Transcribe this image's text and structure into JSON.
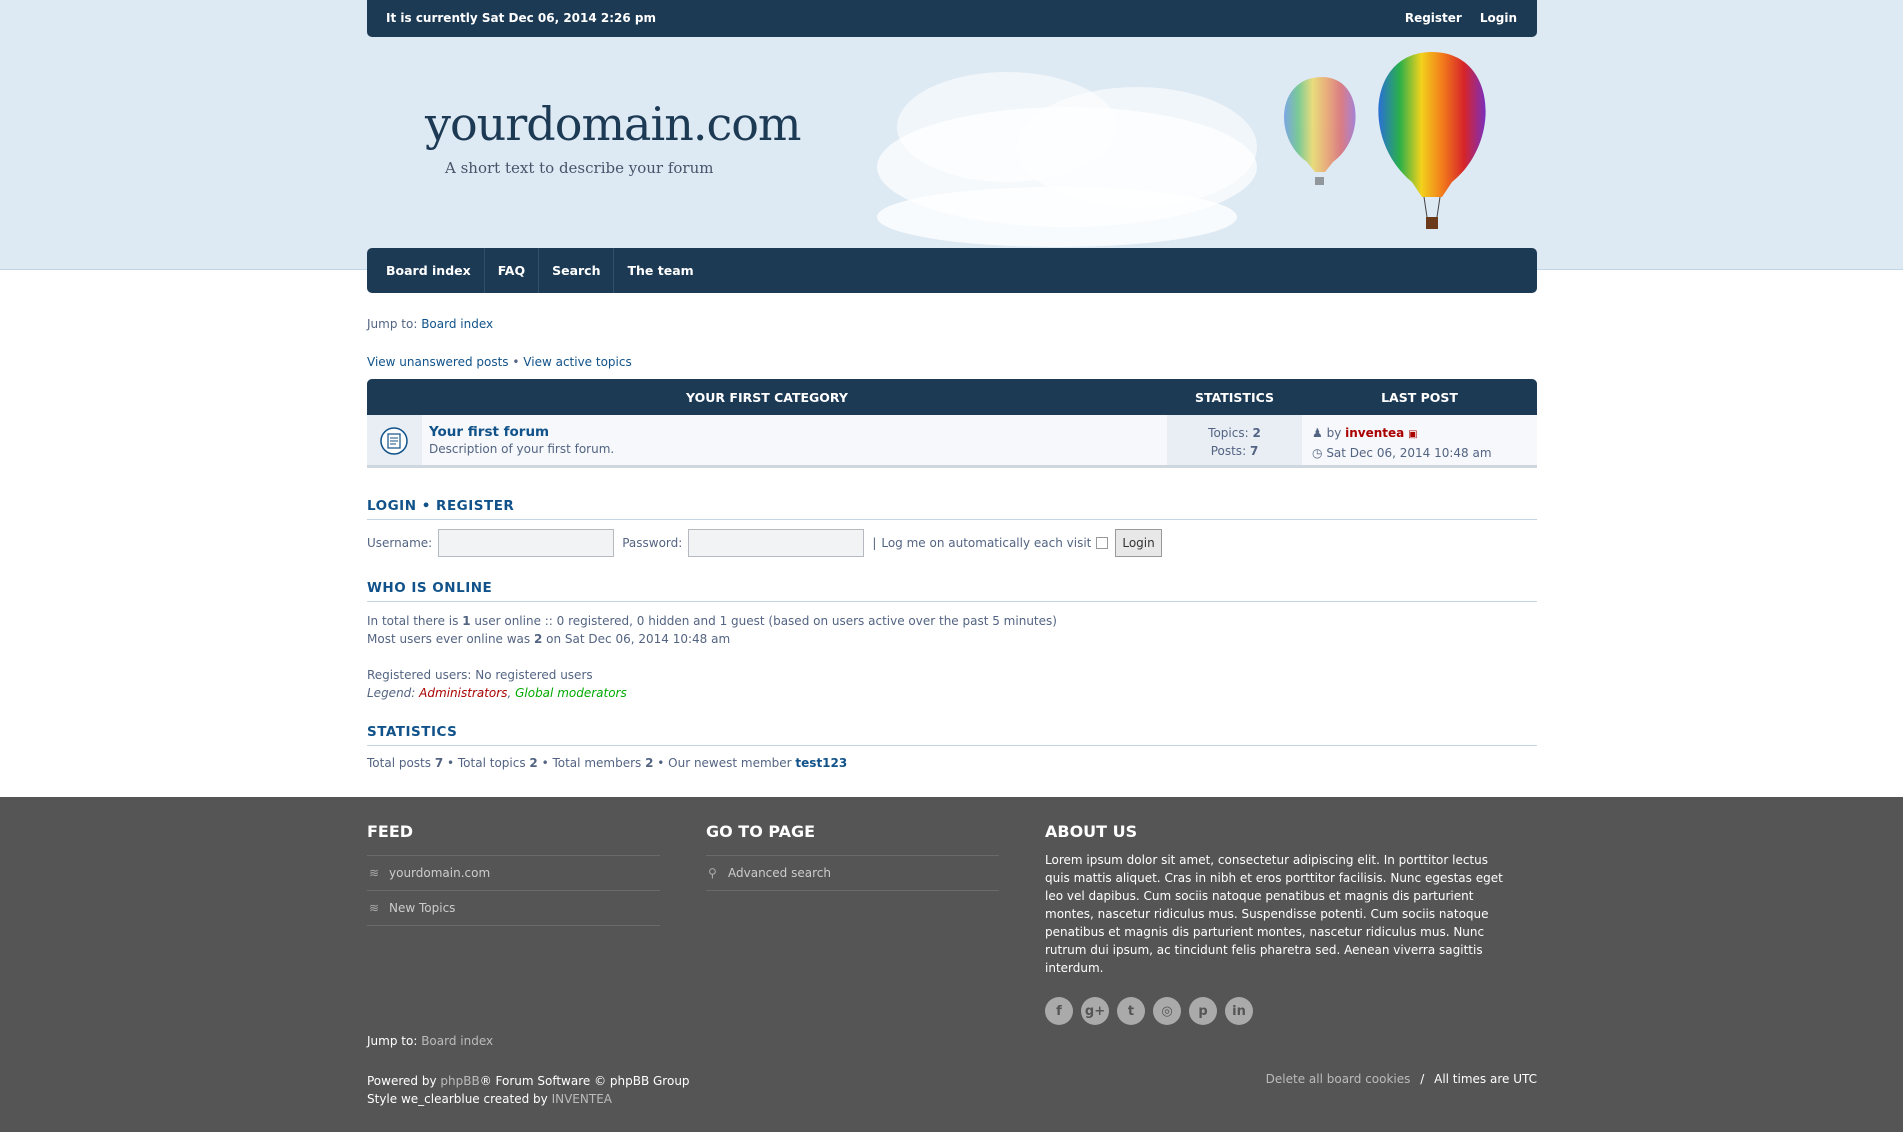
{
  "topbar": {
    "date": "It is currently Sat Dec 06, 2014 2:26 pm",
    "register": "Register",
    "login": "Login"
  },
  "banner": {
    "title": "yourdomain.com",
    "desc": "A short text to describe your forum"
  },
  "nav": [
    "Board index",
    "FAQ",
    "Search",
    "The team"
  ],
  "jump": {
    "label": "Jump to:",
    "target": "Board index"
  },
  "viewlinks": {
    "unanswered": "View unanswered posts",
    "sep": "•",
    "active": "View active topics"
  },
  "forum_table": {
    "headers": [
      "YOUR FIRST CATEGORY",
      "STATISTICS",
      "LAST POST"
    ],
    "row": {
      "name": "Your first forum",
      "desc": "Description of your first forum.",
      "topics_label": "Topics:",
      "topics": "2",
      "posts_label": "Posts:",
      "posts": "7",
      "by": "by",
      "user": "inventea",
      "date": "Sat Dec 06, 2014 10:48 am"
    }
  },
  "login": {
    "title_login": "LOGIN",
    "title_sep": "•",
    "title_register": "REGISTER",
    "username_label": "Username:",
    "password_label": "Password:",
    "remember": "Log me on automatically each visit",
    "button": "Login"
  },
  "online": {
    "title": "WHO IS ONLINE",
    "line1a": "In total there is ",
    "line1b": "1",
    "line1c": " user online :: 0 registered, 0 hidden and 1 guest (based on users active over the past 5 minutes)",
    "line2a": "Most users ever online was ",
    "line2b": "2",
    "line2c": " on Sat Dec 06, 2014 10:48 am",
    "registered": "Registered users: No registered users",
    "legend": "Legend:",
    "admins": "Administrators",
    "comma": ",",
    "mods": "Global moderators"
  },
  "stats": {
    "title": "STATISTICS",
    "posts_label": "Total posts ",
    "posts": "7",
    "topics_label": " • Total topics ",
    "topics": "2",
    "members_label": " • Total members ",
    "members": "2",
    "newest_label": " • Our newest member ",
    "newest": "test123"
  },
  "footer": {
    "feed_title": "FEED",
    "feed_items": [
      "yourdomain.com",
      "New Topics"
    ],
    "goto_title": "GO TO PAGE",
    "goto_items": [
      "Advanced search"
    ],
    "about_title": "ABOUT US",
    "about_text": "Lorem ipsum dolor sit amet, consectetur adipiscing elit. In porttitor lectus quis mattis aliquet. Cras in nibh et eros porttitor facilisis. Nunc egestas eget leo vel dapibus. Cum sociis natoque penatibus et magnis dis parturient montes, nascetur ridiculus mus. Suspendisse potenti. Cum sociis natoque penatibus et magnis dis parturient montes, nascetur ridiculus mus. Nunc rutrum dui ipsum, ac tincidunt felis pharetra sed. Aenean viverra sagittis interdum.",
    "social": [
      "f",
      "g+",
      "t",
      "◎",
      "p",
      "in"
    ],
    "jump_label": "Jump to:",
    "jump_target": "Board index",
    "powered_a": "Powered by ",
    "powered_b": "phpBB",
    "powered_c": "® Forum Software © phpBB Group",
    "style_a": "Style we_clearblue created by ",
    "style_b": "INVENTEA",
    "cookies": "Delete all board cookies",
    "slash": "/",
    "times": "All times are UTC"
  }
}
